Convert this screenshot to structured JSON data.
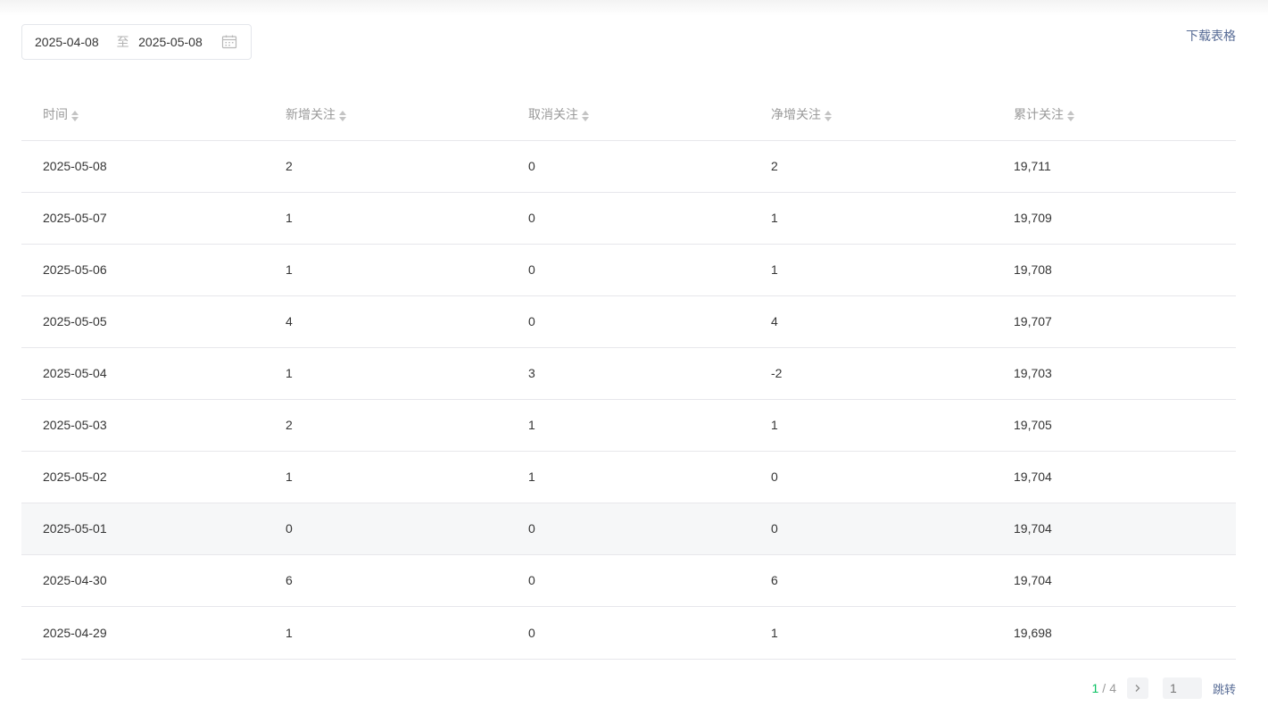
{
  "filter": {
    "start_date": "2025-04-08",
    "separator": "至",
    "end_date": "2025-05-08",
    "calendar_icon": "calendar-icon"
  },
  "toolbar": {
    "download_label": "下载表格"
  },
  "table": {
    "headers": [
      "时间",
      "新增关注",
      "取消关注",
      "净增关注",
      "累计关注"
    ],
    "rows": [
      [
        "2025-05-08",
        "2",
        "0",
        "2",
        "19,711"
      ],
      [
        "2025-05-07",
        "1",
        "0",
        "1",
        "19,709"
      ],
      [
        "2025-05-06",
        "1",
        "0",
        "1",
        "19,708"
      ],
      [
        "2025-05-05",
        "4",
        "0",
        "4",
        "19,707"
      ],
      [
        "2025-05-04",
        "1",
        "3",
        "-2",
        "19,703"
      ],
      [
        "2025-05-03",
        "2",
        "1",
        "1",
        "19,705"
      ],
      [
        "2025-05-02",
        "1",
        "1",
        "0",
        "19,704"
      ],
      [
        "2025-05-01",
        "0",
        "0",
        "0",
        "19,704"
      ],
      [
        "2025-04-30",
        "6",
        "0",
        "6",
        "19,704"
      ],
      [
        "2025-04-29",
        "1",
        "0",
        "1",
        "19,698"
      ]
    ],
    "highlighted_row": 7
  },
  "pagination": {
    "current": "1",
    "total": "4",
    "separator": "/",
    "jump_placeholder": "1",
    "jump_label": "跳转"
  },
  "colors": {
    "accent_green": "#07c160",
    "link_blue": "#576b95",
    "row_highlight": "#f6f7f8"
  }
}
